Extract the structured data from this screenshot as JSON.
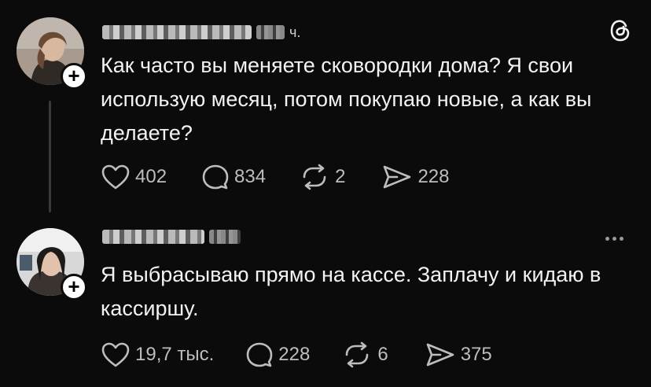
{
  "posts": [
    {
      "username_suffix": "ч.",
      "text": "Как часто вы меняете сковородки дома? Я свои использую месяц, потом покупаю новые, а как вы делаете?",
      "likes": "402",
      "comments": "834",
      "reposts": "2",
      "shares": "228"
    },
    {
      "username_suffix": "",
      "text": "Я выбрасываю прямо на кассе. Заплачу и кидаю в кассиршу.",
      "likes": "19,7 тыс.",
      "comments": "228",
      "reposts": "6",
      "shares": "375"
    }
  ],
  "icons": {
    "like": "heart-icon",
    "comment": "comment-icon",
    "repost": "repost-icon",
    "share": "share-icon",
    "app": "threads-logo-icon",
    "more": "more-options-icon",
    "follow": "plus-icon"
  },
  "colors": {
    "background": "#0b0b0b",
    "text": "#f3f3f3",
    "secondary": "#bdbdbd"
  }
}
